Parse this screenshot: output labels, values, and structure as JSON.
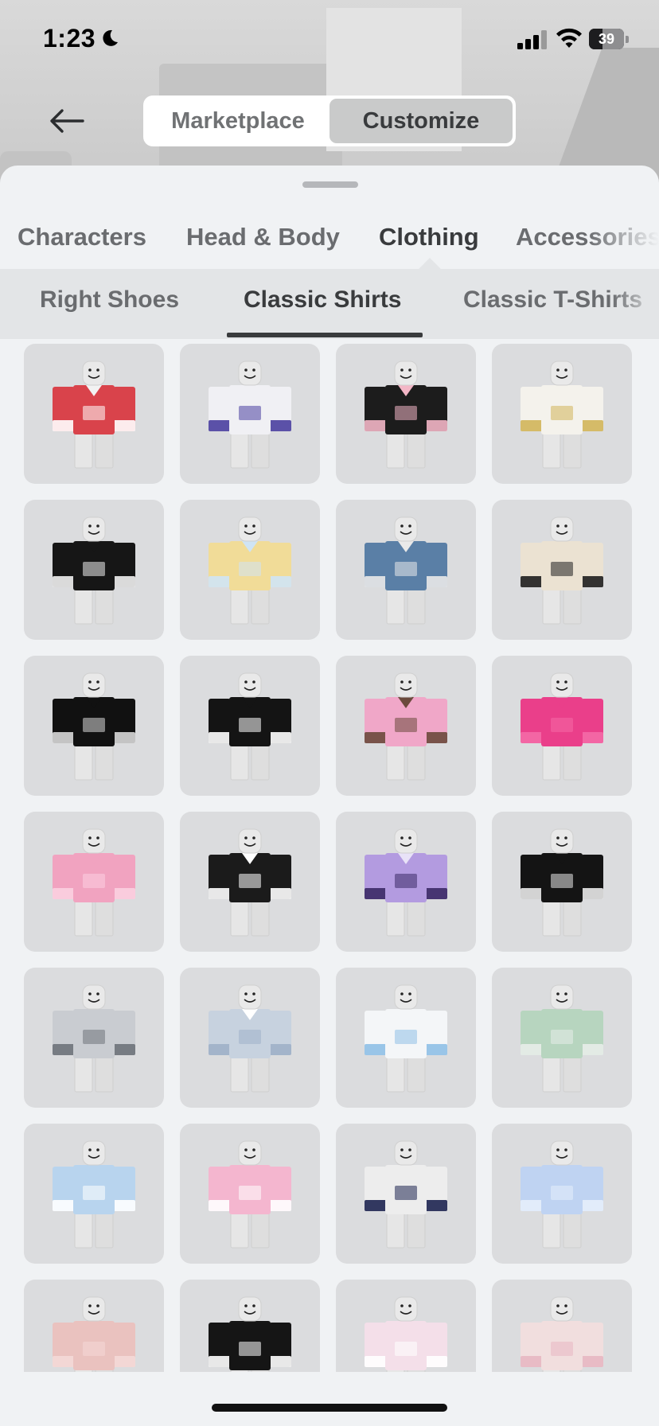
{
  "status_bar": {
    "time": "1:23",
    "battery": "39",
    "battery_level": 0.39,
    "icons": [
      "moon-icon",
      "cellular-signal-icon",
      "wifi-icon",
      "battery-icon"
    ]
  },
  "header": {
    "back_icon": "arrow-left-icon",
    "segments": [
      {
        "label": "Marketplace",
        "active": false
      },
      {
        "label": "Customize",
        "active": true
      }
    ]
  },
  "category_tabs": [
    {
      "label": "Characters",
      "active": false
    },
    {
      "label": "Head & Body",
      "active": false
    },
    {
      "label": "Clothing",
      "active": true
    },
    {
      "label": "Accessories",
      "active": false
    }
  ],
  "sub_tabs": [
    {
      "label": "Right Shoes",
      "active": false
    },
    {
      "label": "Classic Shirts",
      "active": true
    },
    {
      "label": "Classic T-Shirts",
      "active": false
    }
  ],
  "colors": {
    "sheet_bg": "#f0f2f4",
    "tile_bg": "#dbdcde",
    "text_active": "#393b3d",
    "text_inactive": "#6a6c6f"
  },
  "items": [
    {
      "name": "shirt-1",
      "shirt": "#d9434b",
      "accent": "#ffffff",
      "collar": "#f2f2f2"
    },
    {
      "name": "shirt-2",
      "shirt": "#f0f0f4",
      "accent": "#4a3fa0",
      "collar": "#f0f0f4"
    },
    {
      "name": "shirt-3",
      "shirt": "#1c1c1c",
      "accent": "#f3b6c6",
      "collar": "#f3b6c6"
    },
    {
      "name": "shirt-4",
      "shirt": "#f4f2ec",
      "accent": "#d2b55a",
      "collar": "#f4f2ec"
    },
    {
      "name": "shirt-5",
      "shirt": "#161616",
      "accent": "#f0f0f0",
      "collar": "#161616"
    },
    {
      "name": "shirt-6",
      "shirt": "#f1dc98",
      "accent": "#cfe4f5",
      "collar": "#cfe4f5"
    },
    {
      "name": "shirt-7",
      "shirt": "#5a7fa6",
      "accent": "#e9e9e9",
      "collar": "#e9e9e9"
    },
    {
      "name": "shirt-8",
      "shirt": "#ebe2d2",
      "accent": "#1f1f1f",
      "collar": "#ebe2d2"
    },
    {
      "name": "shirt-9",
      "shirt": "#111111",
      "accent": "#d8d8d8",
      "collar": "#111111"
    },
    {
      "name": "shirt-10",
      "shirt": "#141414",
      "accent": "#ffffff",
      "collar": "#141414"
    },
    {
      "name": "shirt-11",
      "shirt": "#f0a7c8",
      "accent": "#6b4a3c",
      "collar": "#6b4a3c"
    },
    {
      "name": "shirt-12",
      "shirt": "#ea3f8a",
      "accent": "#f46aa6",
      "collar": "#ea3f8a"
    },
    {
      "name": "shirt-13",
      "shirt": "#f1a3c0",
      "accent": "#fbd0e0",
      "collar": "#f1a3c0"
    },
    {
      "name": "shirt-14",
      "shirt": "#1b1b1b",
      "accent": "#ffffff",
      "collar": "#ffffff"
    },
    {
      "name": "shirt-15",
      "shirt": "#b39be0",
      "accent": "#3b2a66",
      "collar": "#e8e2f7"
    },
    {
      "name": "shirt-16",
      "shirt": "#141414",
      "accent": "#e8e8e8",
      "collar": "#141414"
    },
    {
      "name": "shirt-17",
      "shirt": "#c9ccd1",
      "accent": "#6e737a",
      "collar": "#c9ccd1"
    },
    {
      "name": "shirt-18",
      "shirt": "#c7d2df",
      "accent": "#9fb0c8",
      "collar": "#ffffff"
    },
    {
      "name": "shirt-19",
      "shirt": "#f4f6f8",
      "accent": "#8fc0e6",
      "collar": "#f4f6f8"
    },
    {
      "name": "shirt-20",
      "shirt": "#b7d5bf",
      "accent": "#e8ede9",
      "collar": "#b7d5bf"
    },
    {
      "name": "shirt-21",
      "shirt": "#b8d4ee",
      "accent": "#ffffff",
      "collar": "#b8d4ee"
    },
    {
      "name": "shirt-22",
      "shirt": "#f4b6cf",
      "accent": "#ffffff",
      "collar": "#f4b6cf"
    },
    {
      "name": "shirt-23",
      "shirt": "#ededed",
      "accent": "#1d2450",
      "collar": "#ededed"
    },
    {
      "name": "shirt-24",
      "shirt": "#bfd3f2",
      "accent": "#e5eefb",
      "collar": "#bfd3f2"
    },
    {
      "name": "shirt-25",
      "shirt": "#eac2bf",
      "accent": "#f4d9d7",
      "collar": "#eac2bf"
    },
    {
      "name": "shirt-26",
      "shirt": "#151515",
      "accent": "#ffffff",
      "collar": "#151515"
    },
    {
      "name": "shirt-27",
      "shirt": "#f4dfe9",
      "accent": "#ffffff",
      "collar": "#f4dfe9"
    },
    {
      "name": "shirt-28",
      "shirt": "#f1dede",
      "accent": "#e7b7c2",
      "collar": "#f1dede"
    }
  ]
}
